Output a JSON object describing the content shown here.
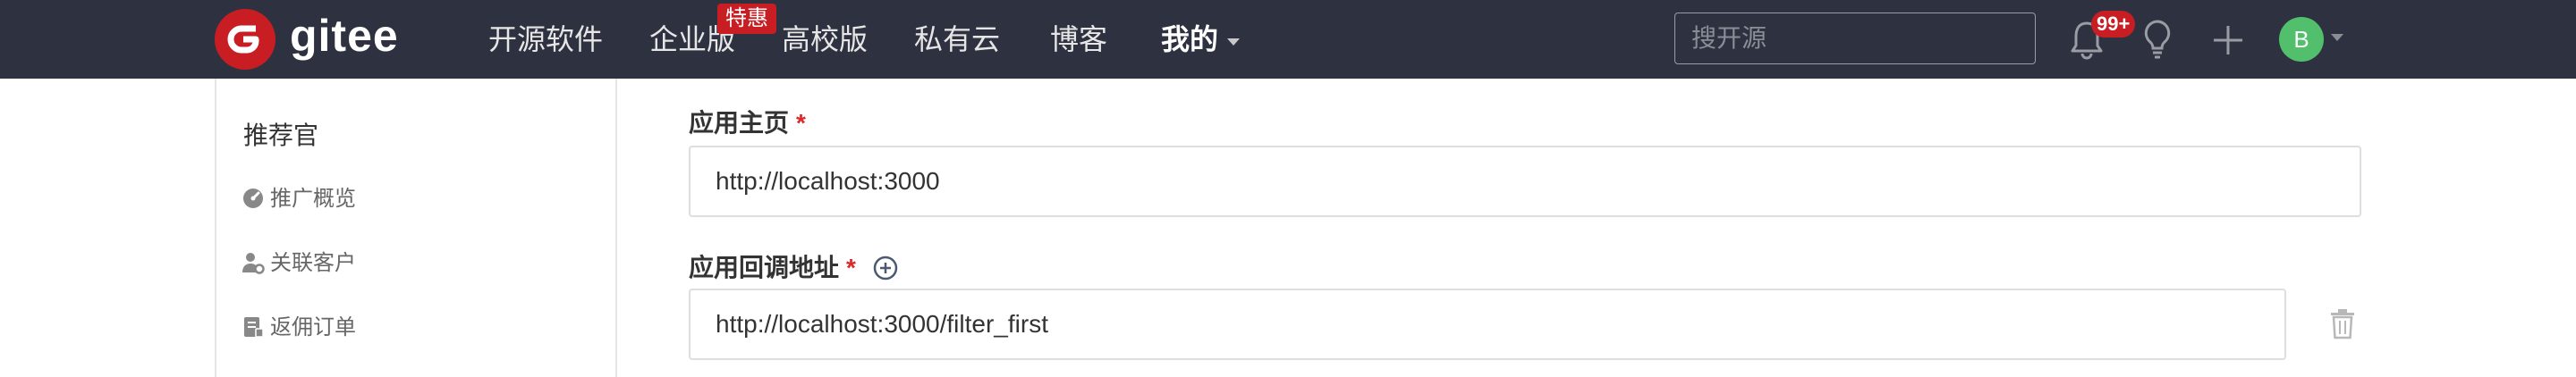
{
  "navbar": {
    "logo_text": "gitee",
    "logo_icon": "gitee-g-logo",
    "items": [
      {
        "label": "开源软件"
      },
      {
        "label": "企业版"
      },
      {
        "label": "高校版"
      },
      {
        "label": "私有云"
      },
      {
        "label": "博客"
      },
      {
        "label": "我的"
      }
    ],
    "enterprise_badge": "特惠",
    "search_placeholder": "搜开源",
    "notification_count": "99+",
    "avatar_letter": "B",
    "icons": [
      "bell-icon",
      "bulb-icon",
      "plus-icon"
    ],
    "colors": {
      "bar": "#2e3240",
      "brand": "#c71d23",
      "avatar": "#52bf6c"
    }
  },
  "sidebar": {
    "title": "推荐官",
    "items": [
      {
        "label": "推广概览",
        "icon": "gauge-icon"
      },
      {
        "label": "关联客户",
        "icon": "user-link-icon"
      },
      {
        "label": "返佣订单",
        "icon": "order-icon"
      }
    ]
  },
  "form": {
    "homepage": {
      "label": "应用主页",
      "required_mark": "*",
      "value": "http://localhost:3000"
    },
    "callback": {
      "label": "应用回调地址",
      "required_mark": "*",
      "value": "http://localhost:3000/filter_first",
      "add_icon": "add-circle-icon",
      "delete_icon": "trash-icon"
    }
  }
}
